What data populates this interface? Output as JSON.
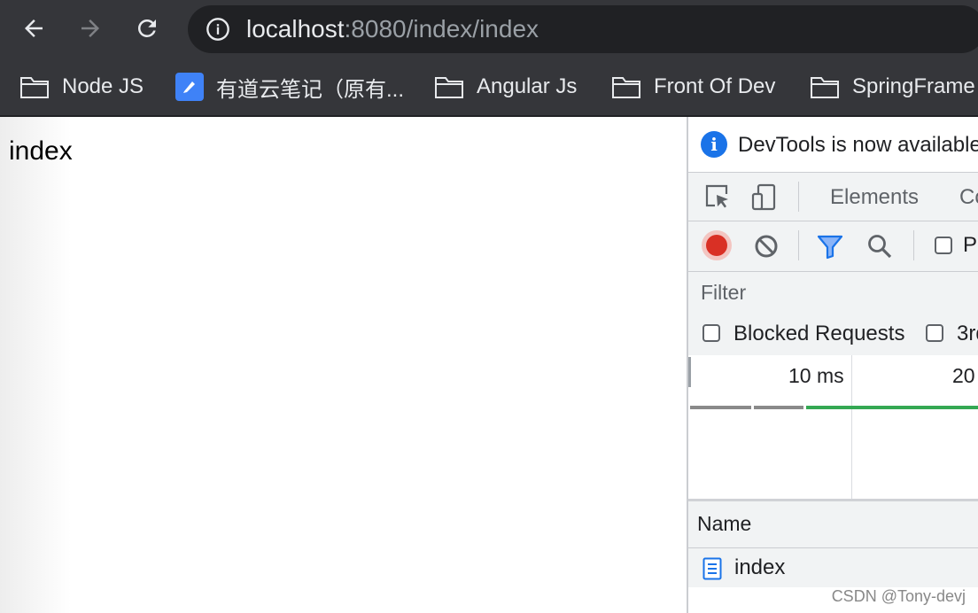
{
  "browser": {
    "url_host": "localhost",
    "url_rest": ":8080/index/index",
    "icons": [
      "back-icon",
      "forward-icon",
      "reload-icon",
      "site-info-icon"
    ]
  },
  "bookmarks": [
    {
      "label": "Node JS",
      "icon": "folder-icon"
    },
    {
      "label": "有道云笔记（原有...",
      "icon": "youdao-note-icon"
    },
    {
      "label": "Angular Js",
      "icon": "folder-icon"
    },
    {
      "label": "Front Of Dev",
      "icon": "folder-icon"
    },
    {
      "label": "SpringFrame",
      "icon": "folder-icon"
    }
  ],
  "page": {
    "text": "index"
  },
  "devtools": {
    "banner_text": "DevTools is now available",
    "tabs": [
      "Elements",
      "Co"
    ],
    "network_toolbar": {
      "preserve_label": "P"
    },
    "filter_placeholder": "Filter",
    "checkboxes": [
      "Blocked Requests",
      "3rd"
    ],
    "overview_ticks": [
      "10 ms",
      "20"
    ],
    "column_name": "Name",
    "requests": [
      {
        "name": "index"
      }
    ]
  },
  "colors": {
    "chrome_bg": "#35363a",
    "omnibox_bg": "#202124",
    "record_red": "#d93025",
    "accent_blue": "#1a73e8",
    "timeline_green": "#34a853"
  },
  "watermark": "CSDN @Tony-devj"
}
